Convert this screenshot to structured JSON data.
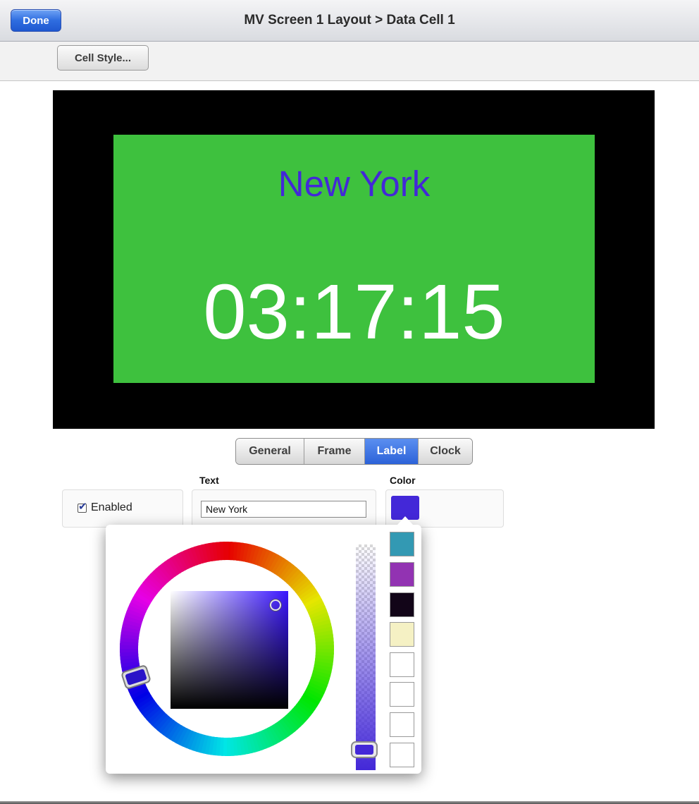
{
  "titlebar": {
    "done_label": "Done",
    "title": "MV Screen 1 Layout > Data Cell 1"
  },
  "toolbar": {
    "cell_style_label": "Cell Style..."
  },
  "preview": {
    "label_text": "New York",
    "clock_text": "03:17:15",
    "cell_background": "#3ec13e",
    "label_color": "#4328d8",
    "clock_color": "#ffffff",
    "frame_color": "#000000"
  },
  "tabs": {
    "items": [
      {
        "label": "General",
        "active": false
      },
      {
        "label": "Frame",
        "active": false
      },
      {
        "label": "Label",
        "active": true
      },
      {
        "label": "Clock",
        "active": false
      }
    ]
  },
  "label_props": {
    "text_header": "Text",
    "color_header": "Color",
    "enabled_label": "Enabled",
    "enabled_checked": true,
    "text_value": "New York",
    "current_color": "#4328d8"
  },
  "color_picker": {
    "selected_color": "#4328d8",
    "opacity": 1.0,
    "recent_colors": [
      "#3399b3",
      "#9233b2",
      "#120518",
      "#f5f1c4",
      "#ffffff",
      "#ffffff",
      "#ffffff",
      "#ffffff"
    ]
  }
}
